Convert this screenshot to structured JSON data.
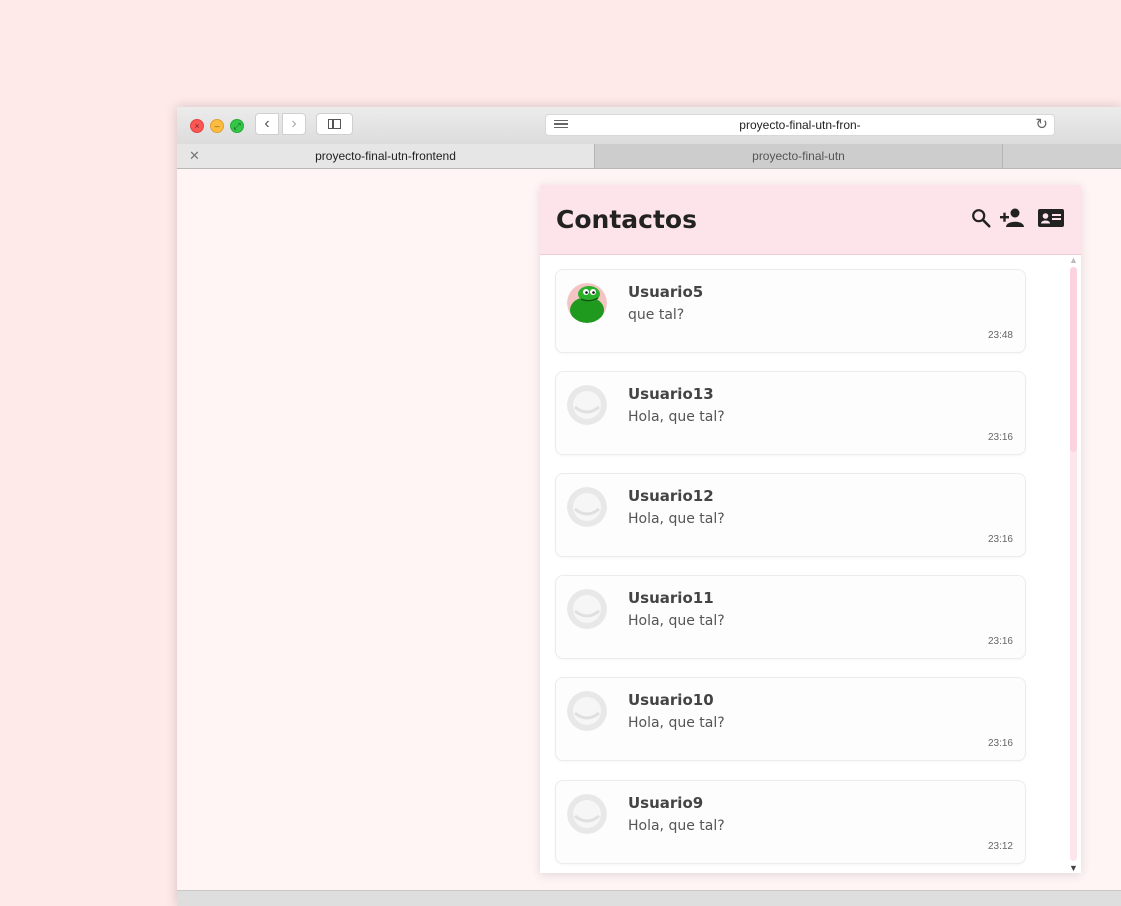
{
  "browser": {
    "url": "proyecto-final-utn-fron-",
    "tabs": [
      {
        "label": "proyecto-final-utn-frontend",
        "active": true
      },
      {
        "label": "proyecto-final-utn",
        "active": false
      }
    ],
    "close_tab_glyph": "✕",
    "back_glyph": "‹",
    "forward_glyph": "›",
    "reload_glyph": "↻"
  },
  "header": {
    "title": "Contactos",
    "icons": [
      "search-icon",
      "add-contact-icon",
      "contact-card-icon"
    ]
  },
  "contacts": [
    {
      "name": "Usuario5",
      "message": "que tal?",
      "time": "23:48",
      "avatar": "frog"
    },
    {
      "name": "Usuario13",
      "message": "Hola, que tal?",
      "time": "23:16",
      "avatar": "default"
    },
    {
      "name": "Usuario12",
      "message": "Hola, que tal?",
      "time": "23:16",
      "avatar": "default"
    },
    {
      "name": "Usuario11",
      "message": "Hola, que tal?",
      "time": "23:16",
      "avatar": "default"
    },
    {
      "name": "Usuario10",
      "message": "Hola, que tal?",
      "time": "23:16",
      "avatar": "default"
    },
    {
      "name": "Usuario9",
      "message": "Hola, que tal?",
      "time": "23:12",
      "avatar": "default"
    }
  ],
  "colors": {
    "page_background": "#ffeaea",
    "header_background": "#fde3ea",
    "scrollbar": "#fbd3de"
  }
}
